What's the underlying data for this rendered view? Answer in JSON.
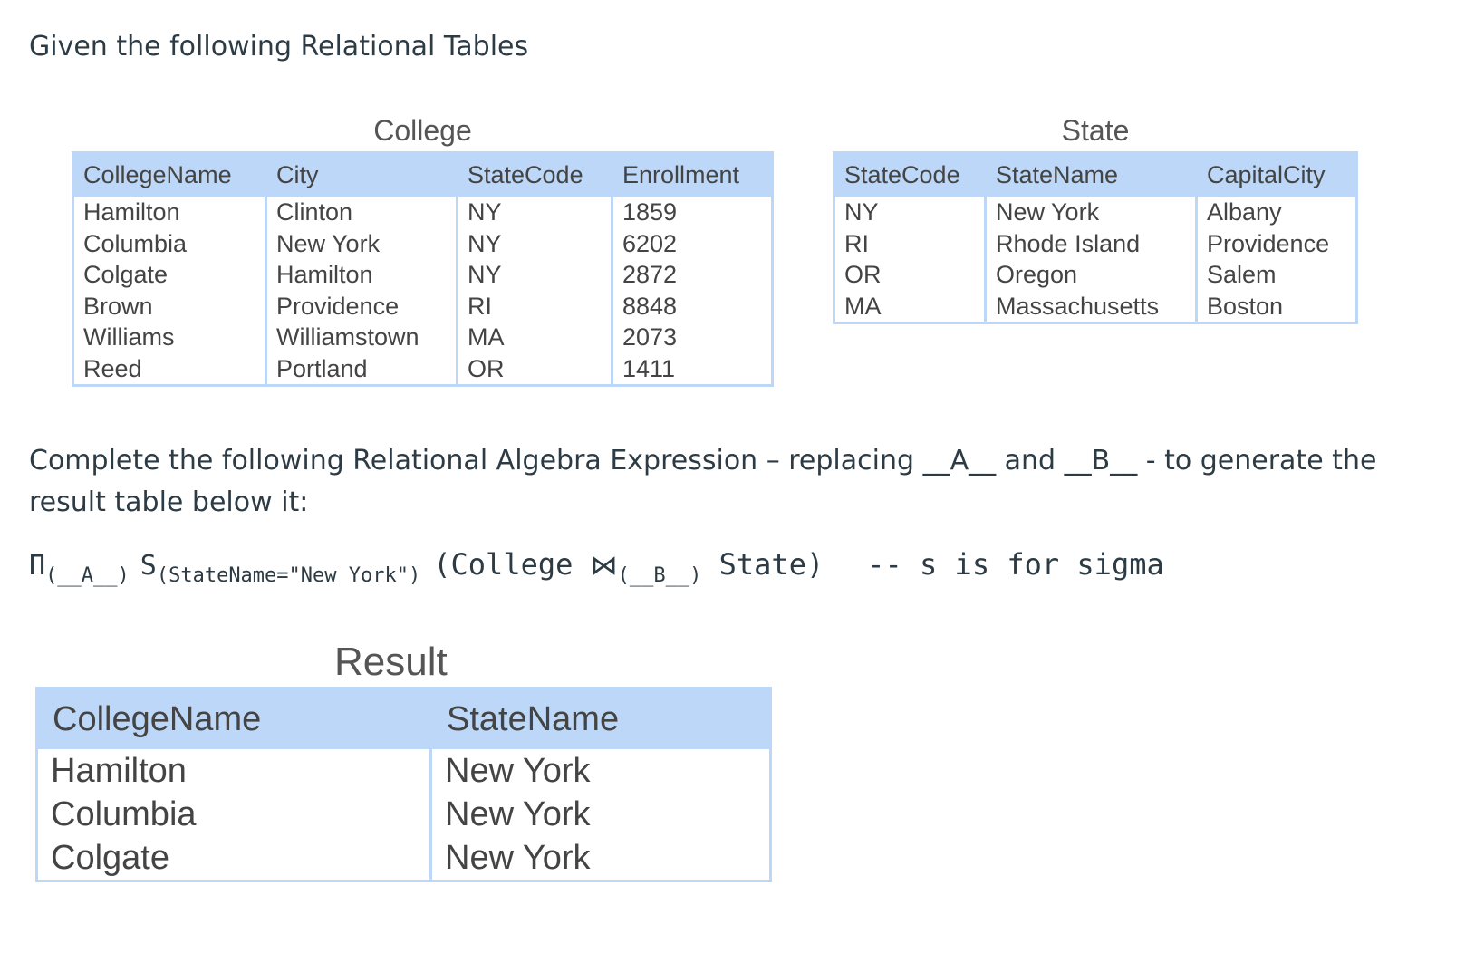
{
  "heading": "Given the following Relational Tables",
  "college": {
    "caption": "College",
    "headers": [
      "CollegeName",
      "City",
      "StateCode",
      "Enrollment"
    ],
    "rows": [
      [
        "Hamilton",
        "Clinton",
        "NY",
        "1859"
      ],
      [
        "Columbia",
        "New York",
        "NY",
        "6202"
      ],
      [
        "Colgate",
        "Hamilton",
        "NY",
        "2872"
      ],
      [
        "Brown",
        "Providence",
        "RI",
        "8848"
      ],
      [
        "Williams",
        "Williamstown",
        "MA",
        "2073"
      ],
      [
        "Reed",
        "Portland",
        "OR",
        "1411"
      ]
    ]
  },
  "state": {
    "caption": "State",
    "headers": [
      "StateCode",
      "StateName",
      "CapitalCity"
    ],
    "rows": [
      [
        "NY",
        "New York",
        "Albany"
      ],
      [
        "RI",
        "Rhode Island",
        "Providence"
      ],
      [
        "OR",
        "Oregon",
        "Salem"
      ],
      [
        "MA",
        "Massachusetts",
        "Boston"
      ]
    ]
  },
  "instruction": "Complete the following Relational Algebra Expression – replacing __A__ and __B__ - to generate the result table below it:",
  "expression": {
    "pi": "Π",
    "a_sub": "(__A__)",
    "sigma": "S",
    "cond_sub": "(StateName=\"New York\")",
    "college_part": "(College ",
    "join": "⋈",
    "b_sub": "(__B__)",
    "state_part": " State)",
    "comment": "-- s is for sigma"
  },
  "result": {
    "caption": "Result",
    "headers": [
      "CollegeName",
      "StateName"
    ],
    "rows": [
      [
        "Hamilton",
        "New York"
      ],
      [
        "Columbia",
        "New York"
      ],
      [
        "Colgate",
        "New York"
      ]
    ]
  }
}
